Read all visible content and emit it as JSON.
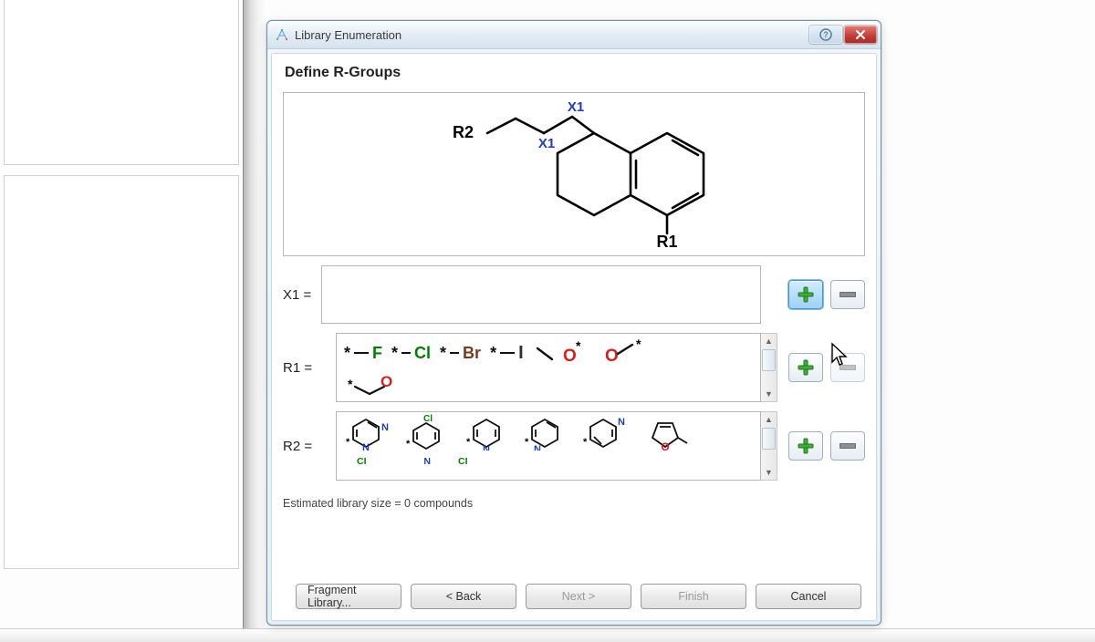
{
  "window": {
    "title": "Library Enumeration"
  },
  "page": {
    "heading": "Define R-Groups",
    "estimate_text": "Estimated library size = 0 compounds"
  },
  "scaffold": {
    "labels": {
      "R1": "R1",
      "R2": "R2",
      "X1a": "X1",
      "X1b": "X1"
    }
  },
  "rgroups": {
    "x1": {
      "label": "X1 =",
      "fragments": []
    },
    "r1": {
      "label": "R1 =",
      "fragments": [
        {
          "display": "*—F",
          "element": "F"
        },
        {
          "display": "*—Cl",
          "element": "Cl"
        },
        {
          "display": "*—Br",
          "element": "Br"
        },
        {
          "display": "*—I",
          "element": "I"
        },
        {
          "display": "*—O—*",
          "element": "O"
        },
        {
          "display": "O—*",
          "element": "O"
        },
        {
          "display": "*—(O)",
          "element": "O"
        }
      ]
    },
    "r2": {
      "label": "R2 =",
      "fragments": [
        {
          "type": "heteroaryl",
          "note": "pyridazine-like *—"
        },
        {
          "type": "heteroaryl",
          "note": "Cl/Cl substituted ring *—"
        },
        {
          "type": "heteroaryl",
          "note": "N ring *—"
        },
        {
          "type": "heteroaryl",
          "note": "N ring *—"
        },
        {
          "type": "heteroaryl",
          "note": "N ring *—"
        },
        {
          "type": "heteroaryl",
          "note": "furan-like O ring *—"
        }
      ],
      "overflow_labels": [
        "CI",
        "CI",
        "N",
        "CI"
      ]
    }
  },
  "footer": {
    "fragment_library": "Fragment Library...",
    "back": "< Back",
    "next": "Next >",
    "finish": "Finish",
    "cancel": "Cancel"
  },
  "colors": {
    "nitrogen": "#1d3fb0",
    "oxygen": "#d62020",
    "halogen_green": "#008000",
    "bromine": "#7a3b1e"
  }
}
